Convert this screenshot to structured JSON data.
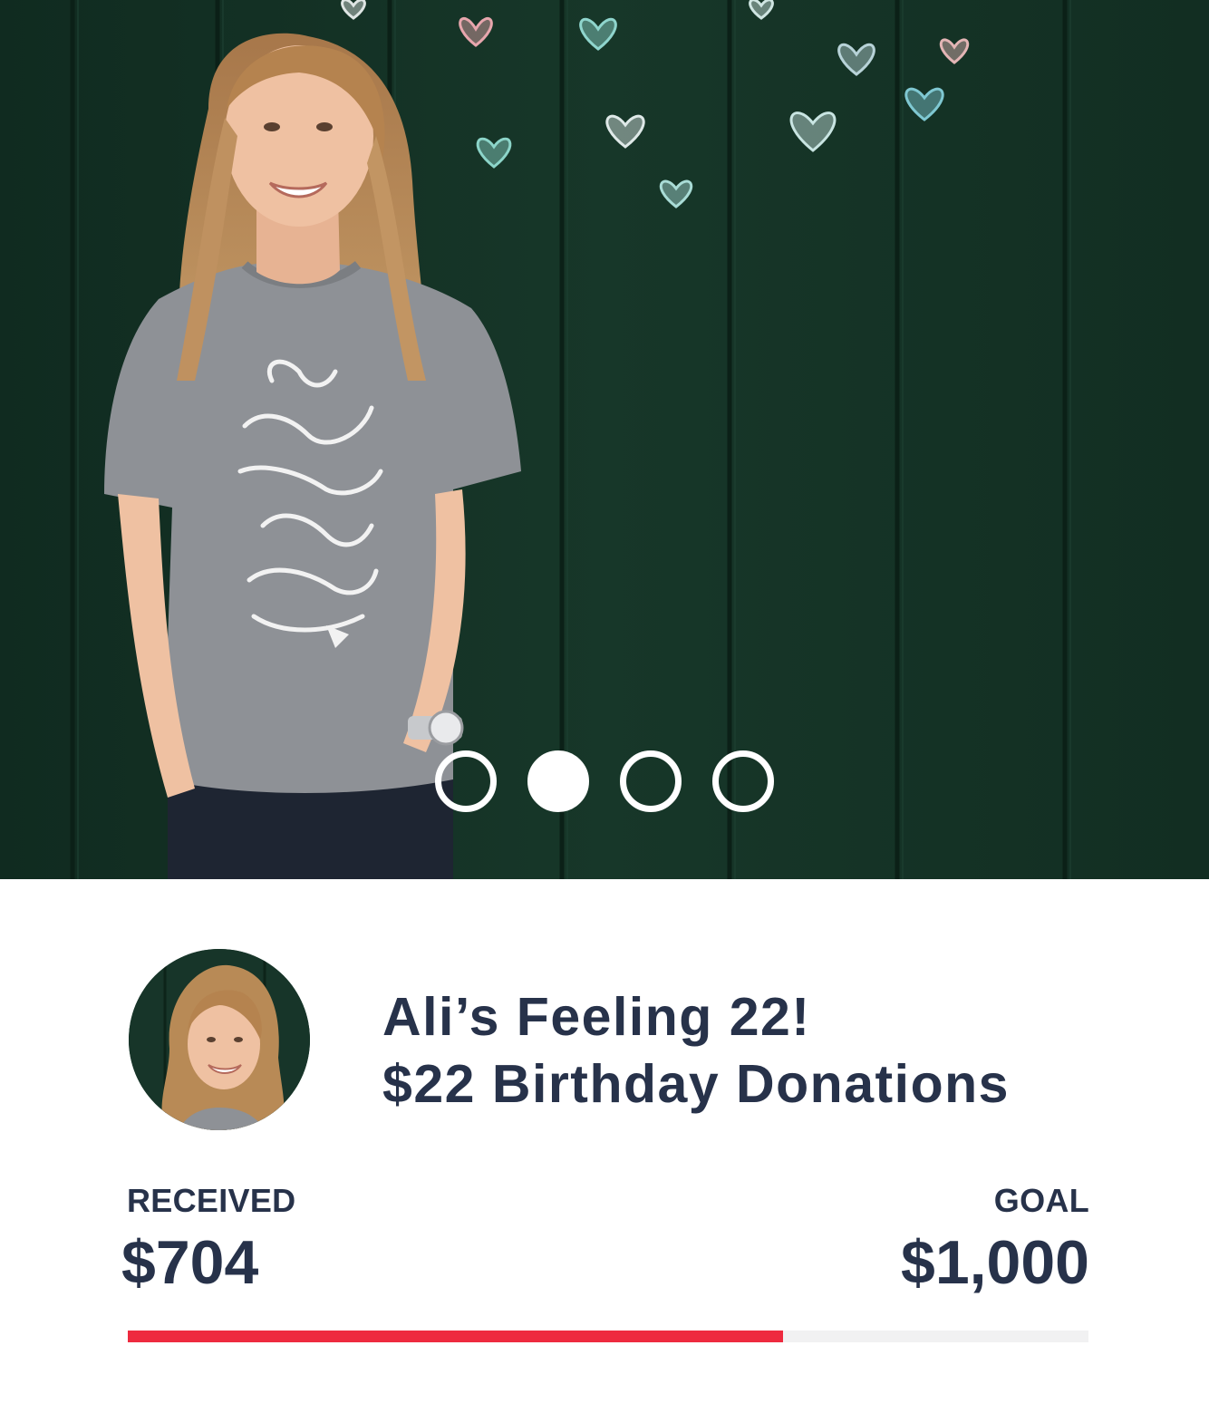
{
  "carousel": {
    "slide_count": 4,
    "active_slide": 2,
    "slides": [
      {
        "label": "slide-1"
      },
      {
        "label": "slide-2"
      },
      {
        "label": "slide-3"
      },
      {
        "label": "slide-4"
      }
    ],
    "shirt_text": "We belong to each other"
  },
  "campaign": {
    "title_line1": "Ali’s Feeling 22!",
    "title_line2": "$22 Birthday Donations"
  },
  "stats": {
    "received_label": "RECEIVED",
    "received_value": "$704",
    "goal_label": "GOAL",
    "goal_value": "$1,000",
    "progress_fraction": 0.682
  },
  "colors": {
    "text": "#27324a",
    "progress_fill": "#ee2a3f",
    "progress_track": "#f1f1f2",
    "wall_green": "#143226"
  }
}
